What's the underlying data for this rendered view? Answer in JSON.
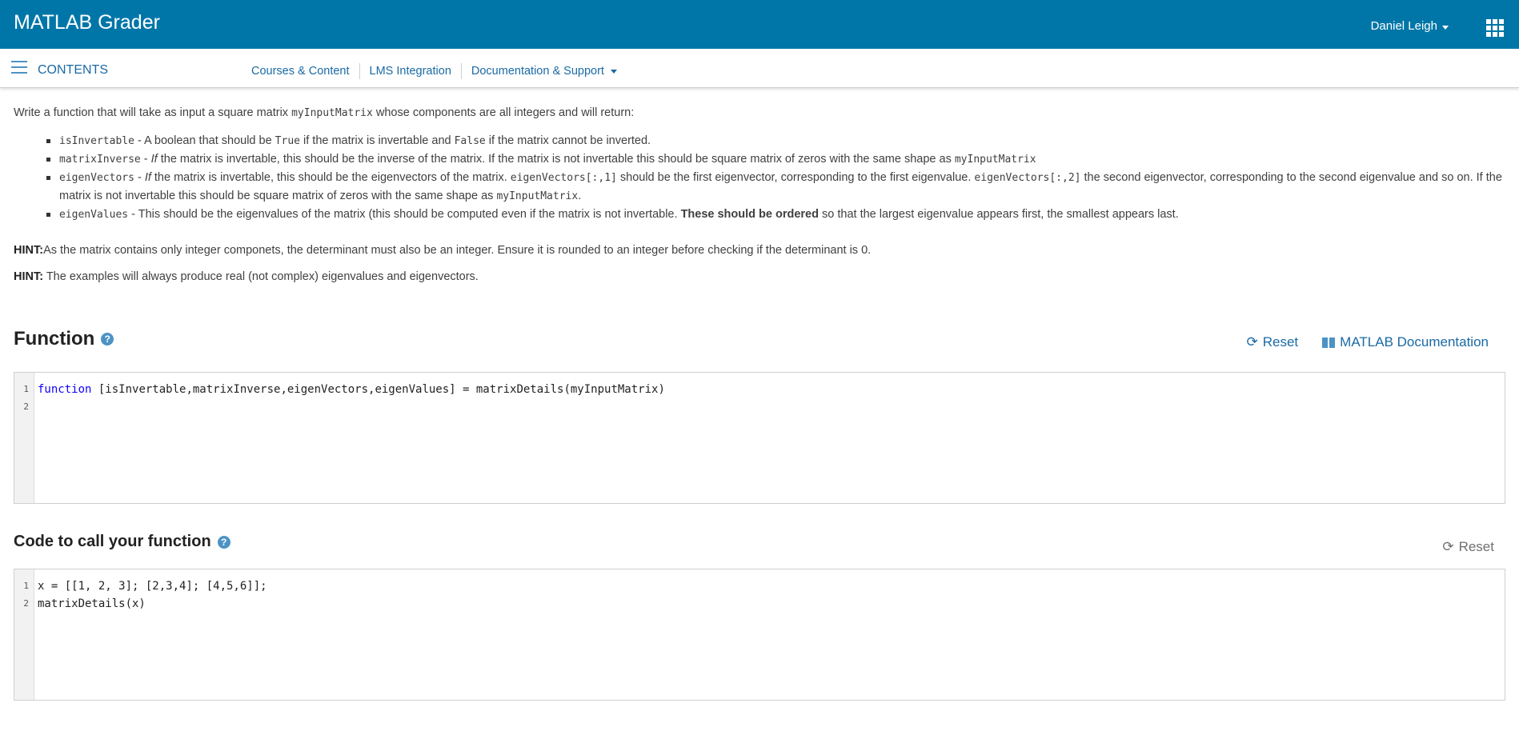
{
  "header": {
    "app_title": "MATLAB Grader",
    "user_name": "Daniel Leigh",
    "user_caret_icon": "caret-down-icon",
    "apps_icon": "apps-grid-icon"
  },
  "nav": {
    "contents_label": "CONTENTS",
    "links": [
      "Courses & Content",
      "LMS Integration",
      "Documentation & Support"
    ]
  },
  "problem": {
    "intro_before": "Write a function that will take as input a square matrix ",
    "intro_code": "myInputMatrix",
    "intro_after": " whose components are all integers and will return:",
    "items": [
      {
        "code": "isInvertable",
        "t1": " - A boolean that should be ",
        "c2": "True",
        "t2": " if the matrix is invertable and ",
        "c3": "False",
        "t3": " if the matrix cannot be inverted."
      },
      {
        "code": "matrixInverse",
        "t1": " - ",
        "em": "If",
        "t2": " the matrix is invertable, this should be the inverse of the matrix. If the matrix is not invertable this should be square matrix of zeros with the same shape as ",
        "c2": "myInputMatrix"
      },
      {
        "code": "eigenVectors",
        "t1": " - ",
        "em": "If",
        "t2": " the matrix is invertable, this should be the eigenvectors of the matrix. ",
        "c2": "eigenVectors[:,1]",
        "t3": " should be the first eigenvector, corresponding to the first eigenvalue. ",
        "c3": "eigenVectors[:,2]",
        "t4": " the second eigenvector, corresponding to the second eigenvalue and so on. If the matrix is not invertable this should be square matrix of zeros with the same shape as ",
        "c4": "myInputMatrix",
        "t5": "."
      },
      {
        "code": "eigenValues",
        "t1": " - This should be the eigenvalues of the matrix (this should be computed even if the matrix is not invertable. ",
        "bold": "These should be ordered",
        "t2": " so that the largest eigenvalue appears first, the smallest appears last."
      }
    ],
    "hint1_label": "HINT:",
    "hint1_text": "As the matrix contains only integer componets, the determinant must also be an integer. Ensure it is rounded to an integer before checking if the determinant is 0.",
    "hint2_label": "HINT:",
    "hint2_text": " The examples will always produce real (not complex) eigenvalues and eigenvectors."
  },
  "function_section": {
    "title": "Function",
    "reset_label": "Reset",
    "doc_label": "MATLAB Documentation",
    "line_numbers": [
      "1",
      "2"
    ],
    "line1_keyword": "function",
    "line1_rest": " [isInvertable,matrixInverse,eigenVectors,eigenValues] = matrixDetails(myInputMatrix)"
  },
  "call_section": {
    "title": "Code to call your function",
    "reset_label": "Reset",
    "line_numbers": [
      "1",
      "2"
    ],
    "lines": [
      "x = [[1, 2, 3]; [2,3,4]; [4,5,6]];",
      "matrixDetails(x)"
    ]
  }
}
